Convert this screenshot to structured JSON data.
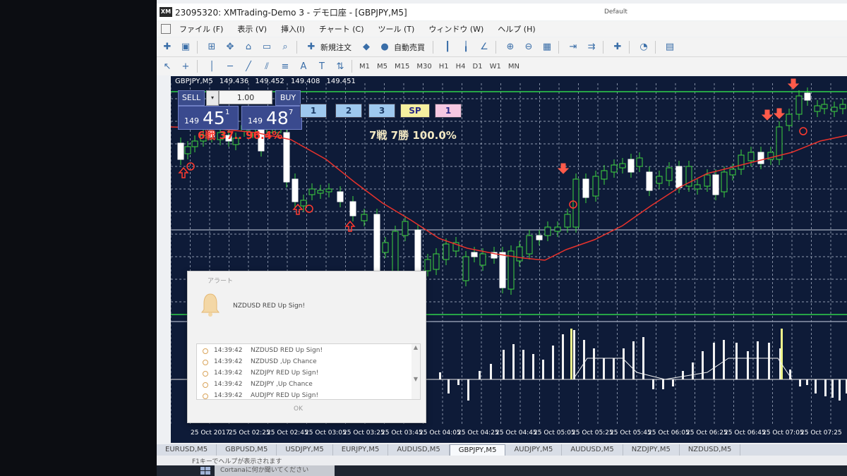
{
  "window": {
    "title": "23095320: XMTrading-Demo 3 - デモ口座 - [GBPJPY,M5]",
    "logo": "XM"
  },
  "menu": [
    "ファイル (F)",
    "表示 (V)",
    "挿入(I)",
    "チャート (C)",
    "ツール (T)",
    "ウィンドウ (W)",
    "ヘルプ (H)"
  ],
  "toolbar": {
    "new_order": "新規注文",
    "auto_trade": "自動売買"
  },
  "timeframes": [
    "M1",
    "M5",
    "M15",
    "M30",
    "H1",
    "H4",
    "D1",
    "W1",
    "MN"
  ],
  "chart": {
    "symbol": "GBPJPY,M5",
    "ohlc": [
      "149.436",
      "149.452",
      "149.408",
      "149.451"
    ],
    "trade_panel": {
      "sell_label": "SELL",
      "buy_label": "BUY",
      "lot": "1.00",
      "sell_price_small": "149",
      "sell_price_big": "45",
      "sell_price_sup": "1",
      "buy_price_small": "149",
      "buy_price_big": "48",
      "buy_price_sup": "7"
    },
    "buttons": [
      "1",
      "2",
      "3",
      "SP",
      "1"
    ],
    "stats_left": "6戦  37..  96.4%",
    "stats_right": "7戦  7勝  100.0%",
    "x_labels": [
      "25 Oct 2017",
      "25 Oct 02:25",
      "25 Oct 02:45",
      "25 Oct 03:05",
      "25 Oct 03:25",
      "25 Oct 03:45",
      "25 Oct 04:05",
      "25 Oct 04:25",
      "25 Oct 04:45",
      "25 Oct 05:05",
      "25 Oct 05:25",
      "25 Oct 05:45",
      "25 Oct 06:05",
      "25 Oct 06:25",
      "25 Oct 06:45",
      "25 Oct 07:05",
      "25 Oct 07:25"
    ],
    "colors": {
      "background": "#0e1b38",
      "grid": "#b9c2d6",
      "bull": "#3fd63f",
      "bear": "#ffffff",
      "ma": "#e8322c",
      "level": "#2fd14a",
      "indicator_highlight": "#eef58a"
    }
  },
  "alert": {
    "title": "アラート",
    "message": "NZDUSD RED Up Sign!",
    "rows": [
      {
        "time": "14:39:42",
        "msg": "NZDUSD RED Up Sign!"
      },
      {
        "time": "14:39:42",
        "msg": "NZDUSD ,Up Chance"
      },
      {
        "time": "14:39:42",
        "msg": "NZDJPY RED Up Sign!"
      },
      {
        "time": "14:39:42",
        "msg": "NZDJPY ,Up Chance"
      },
      {
        "time": "14:39:42",
        "msg": "AUDJPY RED Up Sign!"
      }
    ],
    "ok": "OK"
  },
  "tabs": [
    "EURUSD,M5",
    "GBPUSD,M5",
    "USDJPY,M5",
    "EURJPY,M5",
    "AUDUSD,M5",
    "GBPJPY,M5",
    "AUDJPY,M5",
    "AUDUSD,M5",
    "NZDJPY,M5",
    "NZDUSD,M5"
  ],
  "active_tab": "GBPJPY,M5",
  "status": {
    "help": "F1キーでヘルプが表示されます",
    "profile": "Default"
  },
  "taskbar": {
    "search": "Cortanaに何か聞いてください"
  }
}
